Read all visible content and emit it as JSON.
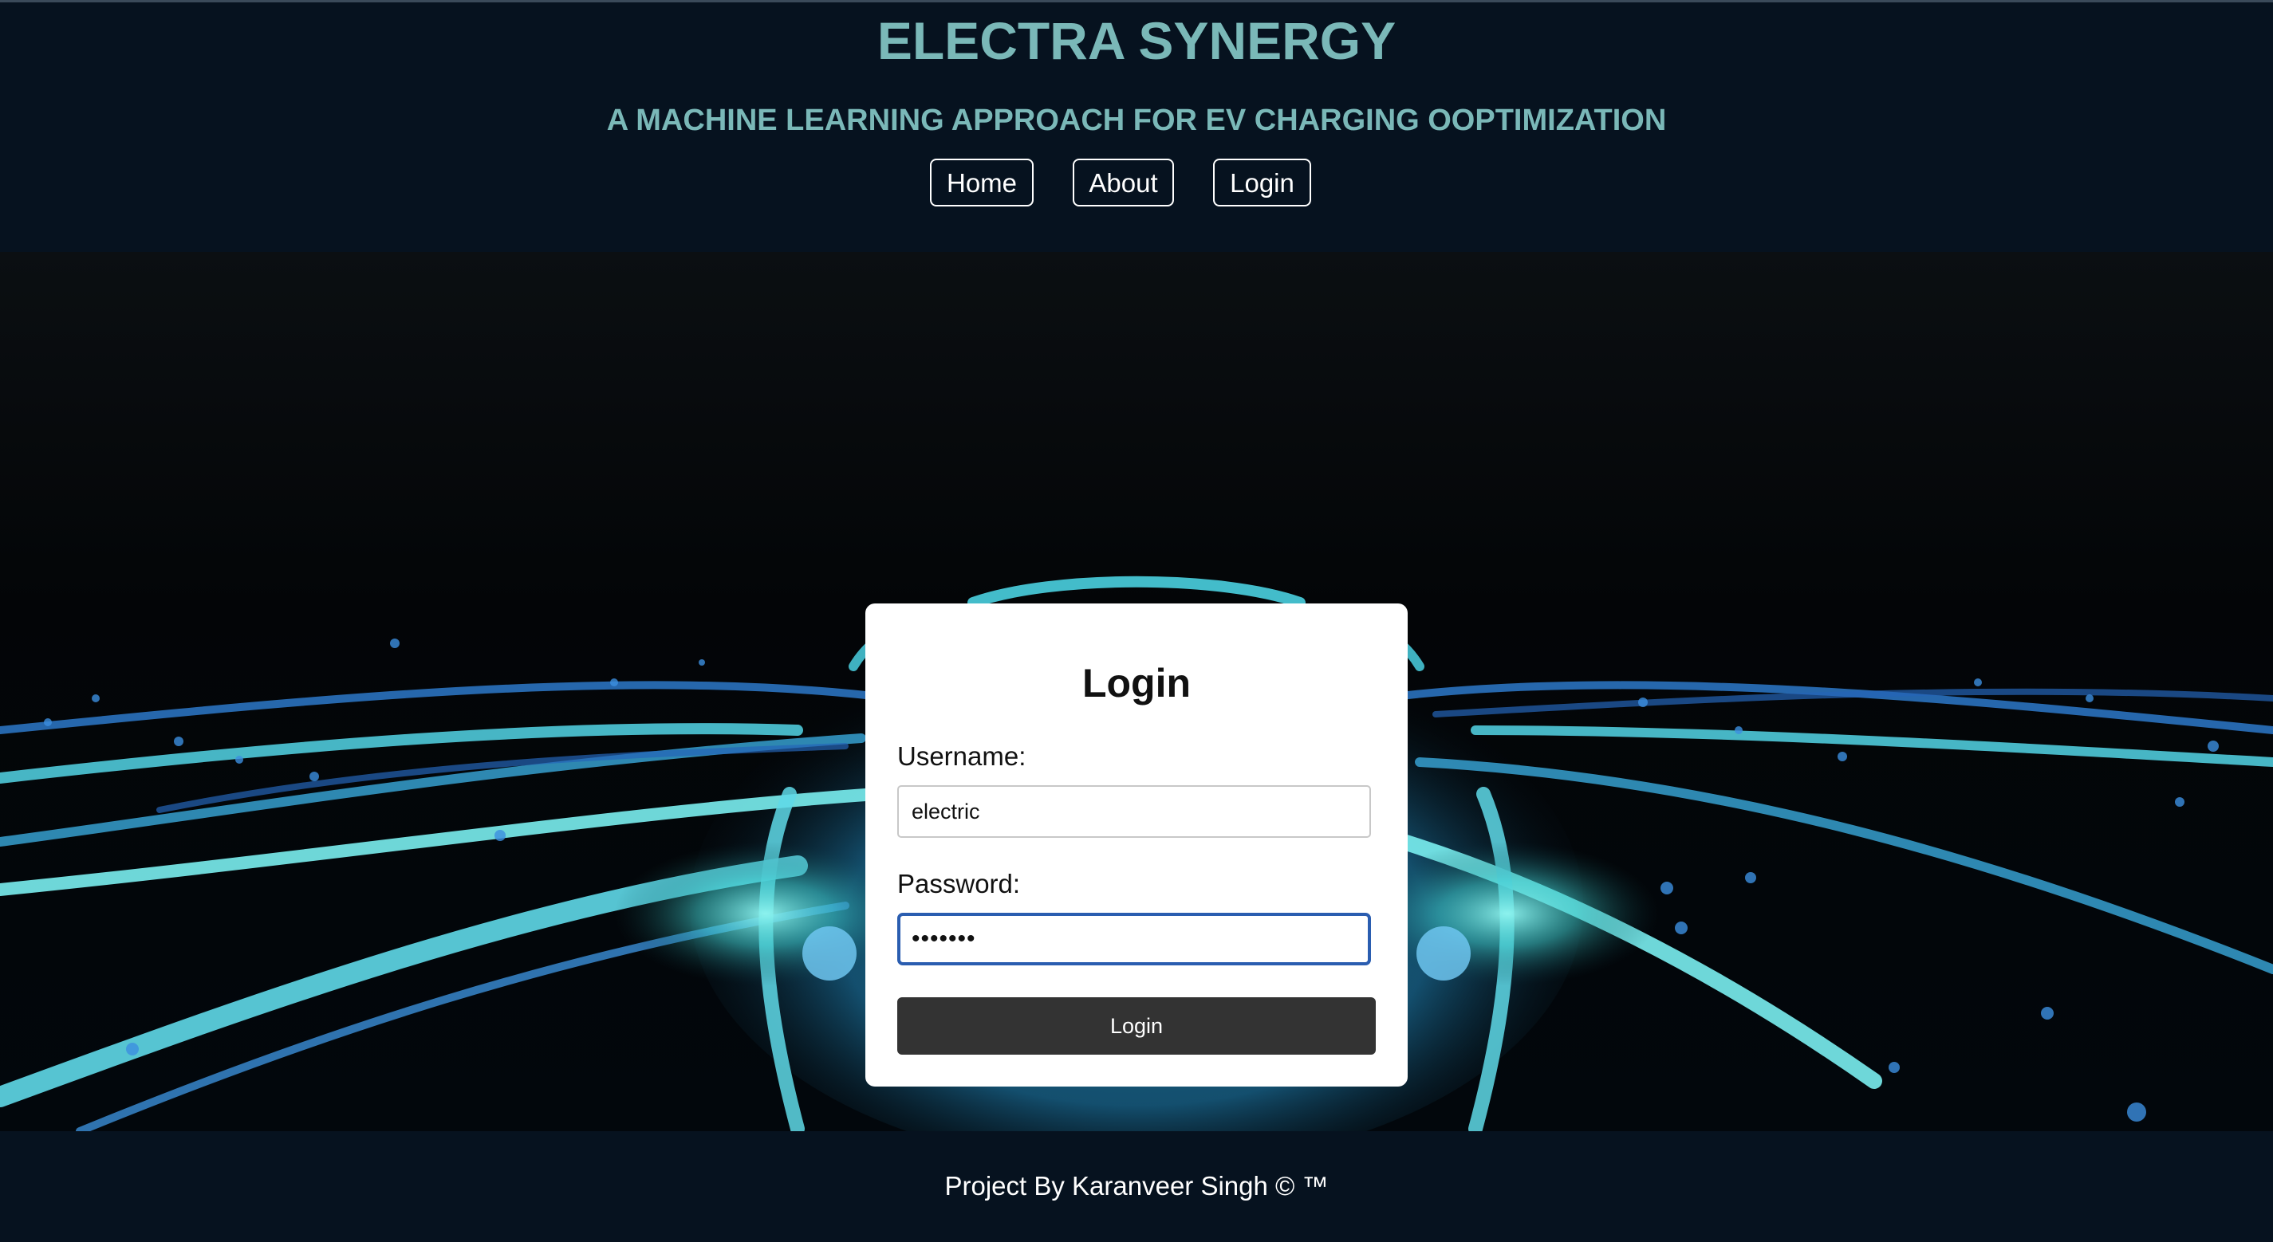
{
  "header": {
    "title": "ELECTRA SYNERGY",
    "subtitle": "A MACHINE LEARNING APPROACH FOR EV CHARGING OOPTIMIZATION"
  },
  "nav": {
    "items": [
      {
        "label": "Home"
      },
      {
        "label": "About"
      },
      {
        "label": "Login"
      }
    ]
  },
  "login_form": {
    "heading": "Login",
    "username_label": "Username:",
    "username_value": "electric",
    "password_label": "Password:",
    "password_value": "*******",
    "submit_label": "Login"
  },
  "footer": {
    "text": "Project By Karanveer Singh © ™"
  },
  "colors": {
    "header_bg": "#06121f",
    "title_teal": "#7ab8b8",
    "glow_cyan": "#6ee8e8",
    "glow_blue": "#2f7fd6",
    "button_dark": "#333333",
    "focus_blue": "#2a5db0"
  }
}
